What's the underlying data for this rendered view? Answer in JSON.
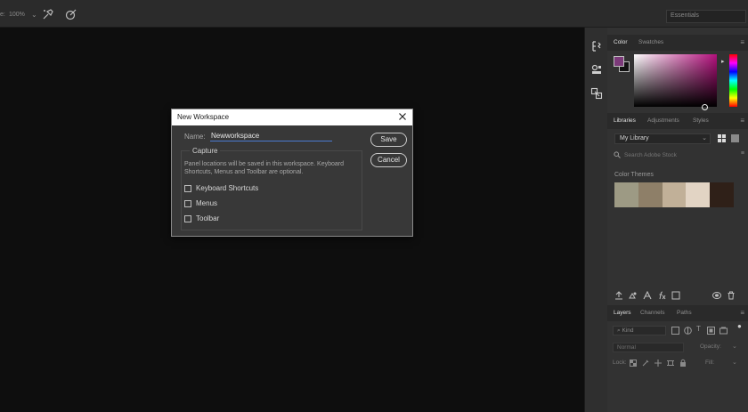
{
  "topbar": {
    "opacity_label": "e:",
    "opacity_value": "100%",
    "workspace": "Essentials"
  },
  "panels": {
    "color": {
      "tabs": [
        "Color",
        "Swatches"
      ],
      "foreground": "#7c3a7a",
      "background": "#111111"
    },
    "libraries": {
      "tabs": [
        "Libraries",
        "Adjustments",
        "Styles"
      ],
      "library_name": "My Library",
      "search_placeholder": "Search Adobe Stock",
      "themes_label": "Color Themes",
      "theme_colors": [
        "#9d9a84",
        "#8e7f68",
        "#c1b098",
        "#e2d4c4",
        "#2f2018"
      ]
    },
    "layers": {
      "tabs": [
        "Layers",
        "Channels",
        "Paths"
      ],
      "kind_label": "Kind",
      "blend_mode": "Normal",
      "opacity_label": "Opacity:",
      "lock_label": "Lock:",
      "fill_label": "Fill:"
    }
  },
  "dialog": {
    "title": "New Workspace",
    "name_label": "Name:",
    "name_value": "Newworkspace",
    "capture_legend": "Capture",
    "description": "Panel locations will be saved in this workspace. Keyboard Shortcuts, Menus and Toolbar are optional.",
    "options": [
      {
        "label": "Keyboard Shortcuts",
        "checked": false
      },
      {
        "label": "Menus",
        "checked": false
      },
      {
        "label": "Toolbar",
        "checked": false
      }
    ],
    "save_label": "Save",
    "cancel_label": "Cancel"
  }
}
